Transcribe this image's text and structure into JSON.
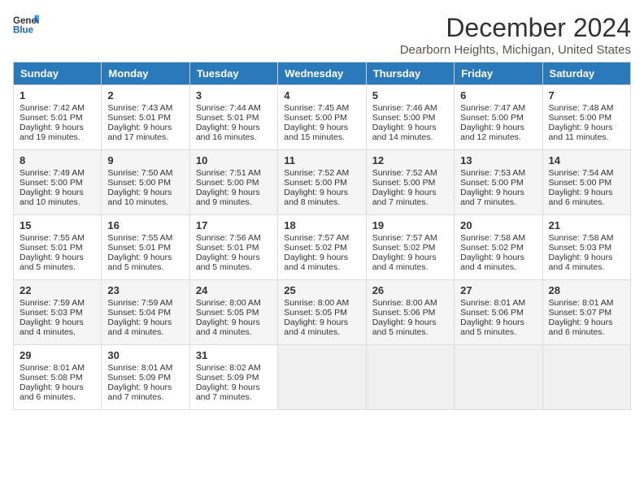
{
  "logo": {
    "line1": "General",
    "line2": "Blue"
  },
  "title": "December 2024",
  "location": "Dearborn Heights, Michigan, United States",
  "headers": [
    "Sunday",
    "Monday",
    "Tuesday",
    "Wednesday",
    "Thursday",
    "Friday",
    "Saturday"
  ],
  "weeks": [
    [
      {
        "day": "1",
        "sunrise": "7:42 AM",
        "sunset": "5:01 PM",
        "daylight": "9 hours and 19 minutes."
      },
      {
        "day": "2",
        "sunrise": "7:43 AM",
        "sunset": "5:01 PM",
        "daylight": "9 hours and 17 minutes."
      },
      {
        "day": "3",
        "sunrise": "7:44 AM",
        "sunset": "5:01 PM",
        "daylight": "9 hours and 16 minutes."
      },
      {
        "day": "4",
        "sunrise": "7:45 AM",
        "sunset": "5:00 PM",
        "daylight": "9 hours and 15 minutes."
      },
      {
        "day": "5",
        "sunrise": "7:46 AM",
        "sunset": "5:00 PM",
        "daylight": "9 hours and 14 minutes."
      },
      {
        "day": "6",
        "sunrise": "7:47 AM",
        "sunset": "5:00 PM",
        "daylight": "9 hours and 12 minutes."
      },
      {
        "day": "7",
        "sunrise": "7:48 AM",
        "sunset": "5:00 PM",
        "daylight": "9 hours and 11 minutes."
      }
    ],
    [
      {
        "day": "8",
        "sunrise": "7:49 AM",
        "sunset": "5:00 PM",
        "daylight": "9 hours and 10 minutes."
      },
      {
        "day": "9",
        "sunrise": "7:50 AM",
        "sunset": "5:00 PM",
        "daylight": "9 hours and 10 minutes."
      },
      {
        "day": "10",
        "sunrise": "7:51 AM",
        "sunset": "5:00 PM",
        "daylight": "9 hours and 9 minutes."
      },
      {
        "day": "11",
        "sunrise": "7:52 AM",
        "sunset": "5:00 PM",
        "daylight": "9 hours and 8 minutes."
      },
      {
        "day": "12",
        "sunrise": "7:52 AM",
        "sunset": "5:00 PM",
        "daylight": "9 hours and 7 minutes."
      },
      {
        "day": "13",
        "sunrise": "7:53 AM",
        "sunset": "5:00 PM",
        "daylight": "9 hours and 7 minutes."
      },
      {
        "day": "14",
        "sunrise": "7:54 AM",
        "sunset": "5:00 PM",
        "daylight": "9 hours and 6 minutes."
      }
    ],
    [
      {
        "day": "15",
        "sunrise": "7:55 AM",
        "sunset": "5:01 PM",
        "daylight": "9 hours and 5 minutes."
      },
      {
        "day": "16",
        "sunrise": "7:55 AM",
        "sunset": "5:01 PM",
        "daylight": "9 hours and 5 minutes."
      },
      {
        "day": "17",
        "sunrise": "7:56 AM",
        "sunset": "5:01 PM",
        "daylight": "9 hours and 5 minutes."
      },
      {
        "day": "18",
        "sunrise": "7:57 AM",
        "sunset": "5:02 PM",
        "daylight": "9 hours and 4 minutes."
      },
      {
        "day": "19",
        "sunrise": "7:57 AM",
        "sunset": "5:02 PM",
        "daylight": "9 hours and 4 minutes."
      },
      {
        "day": "20",
        "sunrise": "7:58 AM",
        "sunset": "5:02 PM",
        "daylight": "9 hours and 4 minutes."
      },
      {
        "day": "21",
        "sunrise": "7:58 AM",
        "sunset": "5:03 PM",
        "daylight": "9 hours and 4 minutes."
      }
    ],
    [
      {
        "day": "22",
        "sunrise": "7:59 AM",
        "sunset": "5:03 PM",
        "daylight": "9 hours and 4 minutes."
      },
      {
        "day": "23",
        "sunrise": "7:59 AM",
        "sunset": "5:04 PM",
        "daylight": "9 hours and 4 minutes."
      },
      {
        "day": "24",
        "sunrise": "8:00 AM",
        "sunset": "5:05 PM",
        "daylight": "9 hours and 4 minutes."
      },
      {
        "day": "25",
        "sunrise": "8:00 AM",
        "sunset": "5:05 PM",
        "daylight": "9 hours and 4 minutes."
      },
      {
        "day": "26",
        "sunrise": "8:00 AM",
        "sunset": "5:06 PM",
        "daylight": "9 hours and 5 minutes."
      },
      {
        "day": "27",
        "sunrise": "8:01 AM",
        "sunset": "5:06 PM",
        "daylight": "9 hours and 5 minutes."
      },
      {
        "day": "28",
        "sunrise": "8:01 AM",
        "sunset": "5:07 PM",
        "daylight": "9 hours and 6 minutes."
      }
    ],
    [
      {
        "day": "29",
        "sunrise": "8:01 AM",
        "sunset": "5:08 PM",
        "daylight": "9 hours and 6 minutes."
      },
      {
        "day": "30",
        "sunrise": "8:01 AM",
        "sunset": "5:09 PM",
        "daylight": "9 hours and 7 minutes."
      },
      {
        "day": "31",
        "sunrise": "8:02 AM",
        "sunset": "5:09 PM",
        "daylight": "9 hours and 7 minutes."
      },
      null,
      null,
      null,
      null
    ]
  ],
  "labels": {
    "sunrise": "Sunrise:",
    "sunset": "Sunset:",
    "daylight": "Daylight:"
  }
}
